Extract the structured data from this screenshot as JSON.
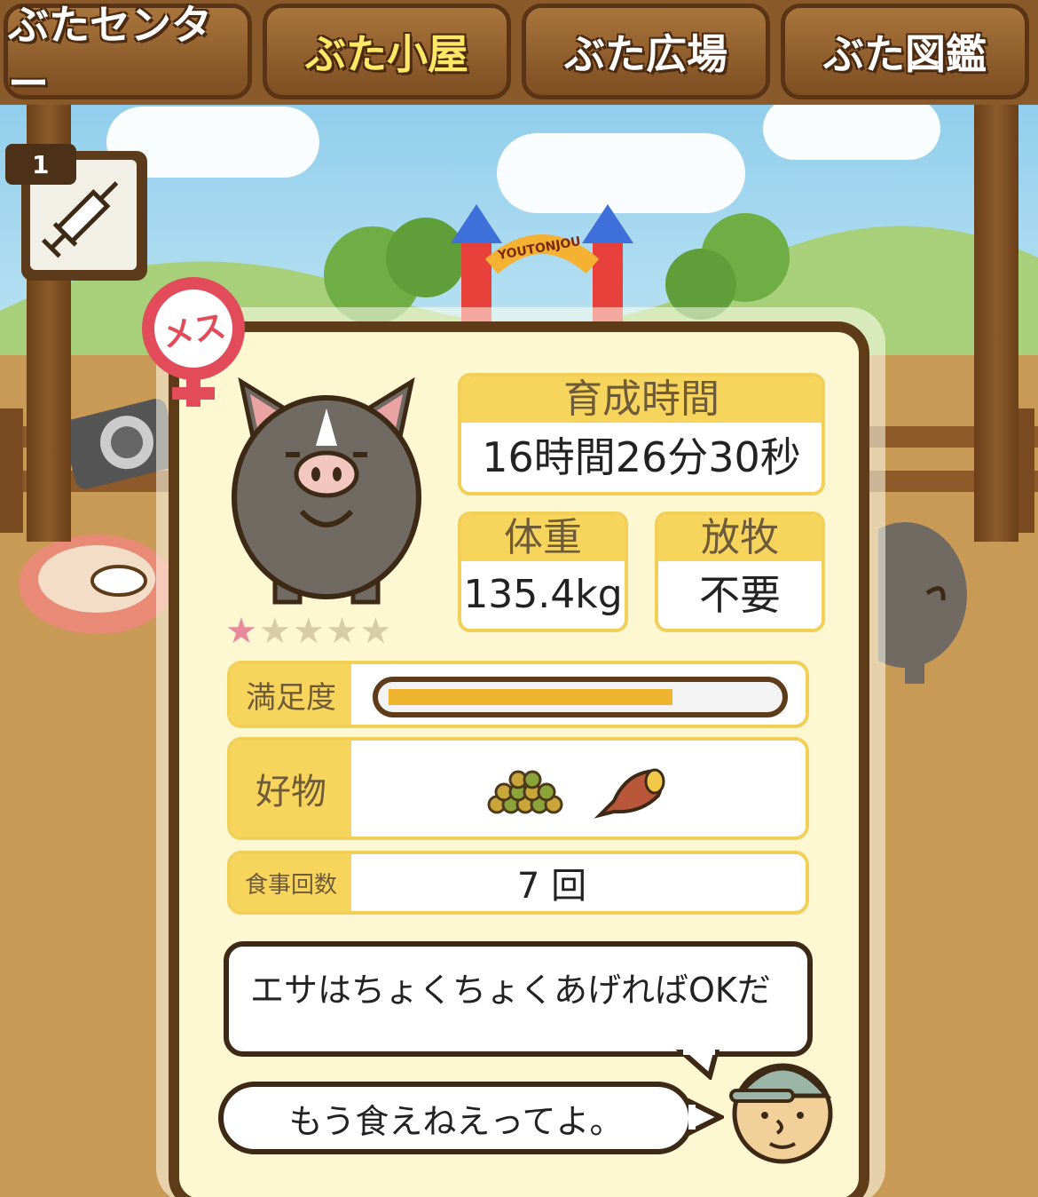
{
  "tabs": [
    {
      "label": "ぶたセンター",
      "active": false
    },
    {
      "label": "ぶた小屋",
      "active": true
    },
    {
      "label": "ぶた広場",
      "active": false
    },
    {
      "label": "ぶた図鑑",
      "active": false
    }
  ],
  "item_slot": {
    "count": "1",
    "icon": "syringe-icon"
  },
  "background_sign": "YOUTONJOU",
  "pig": {
    "gender_badge": "メス",
    "rating": {
      "filled": 1,
      "total": 5
    }
  },
  "stats": {
    "growth_time": {
      "label": "育成時間",
      "value": "16時間26分30秒"
    },
    "weight": {
      "label": "体重",
      "value": "135.4kg"
    },
    "grazing": {
      "label": "放牧",
      "value": "不要"
    }
  },
  "satisfaction": {
    "label": "満足度",
    "level": 0.72
  },
  "favorites": {
    "label": "好物",
    "items": [
      "beans-icon",
      "sweet-potato-icon"
    ]
  },
  "meals": {
    "label": "食事回数",
    "value": "7 回"
  },
  "messages": {
    "tip": "エサはちょくちょくあげればOKだ",
    "pig_says": "もう食えねえってよ。"
  },
  "colors": {
    "accent": "#f7d55c",
    "frame": "#5e3c1a",
    "panel": "#fdf7d2"
  }
}
